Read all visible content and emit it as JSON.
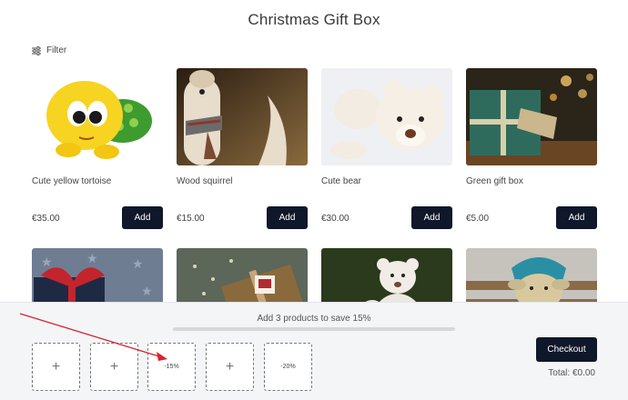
{
  "page": {
    "title": "Christmas Gift Box"
  },
  "filter": {
    "label": "Filter",
    "icon": "sliders-icon"
  },
  "products": [
    {
      "name": "Cute yellow tortoise",
      "price": "€35.00",
      "add_label": "Add",
      "image": "yellow-tortoise"
    },
    {
      "name": "Wood squirrel",
      "price": "€15.00",
      "add_label": "Add",
      "image": "wood-squirrel"
    },
    {
      "name": "Cute bear",
      "price": "€30.00",
      "add_label": "Add",
      "image": "cute-bear"
    },
    {
      "name": "Green gift box",
      "price": "€5.00",
      "add_label": "Add",
      "image": "green-gift-box"
    },
    {
      "image": "red-ribbon-gift"
    },
    {
      "image": "wrapped-gift-bow"
    },
    {
      "image": "teddy-bear-forest"
    },
    {
      "image": "sheep-toy"
    }
  ],
  "bundle": {
    "save_text": "Add 3 products to save 15%",
    "progress_fraction": 0,
    "slots": [
      {
        "type": "empty",
        "icon": "plus-icon"
      },
      {
        "type": "empty",
        "icon": "plus-icon"
      },
      {
        "type": "discount",
        "label": "-15%"
      },
      {
        "type": "empty",
        "icon": "plus-icon"
      },
      {
        "type": "discount",
        "label": "-20%"
      }
    ],
    "checkout_label": "Checkout",
    "total_text": "Total: €0.00"
  },
  "colors": {
    "primary": "#0f172a",
    "annotation_arrow": "#d9232e",
    "bar_bg": "#f4f5f7"
  }
}
